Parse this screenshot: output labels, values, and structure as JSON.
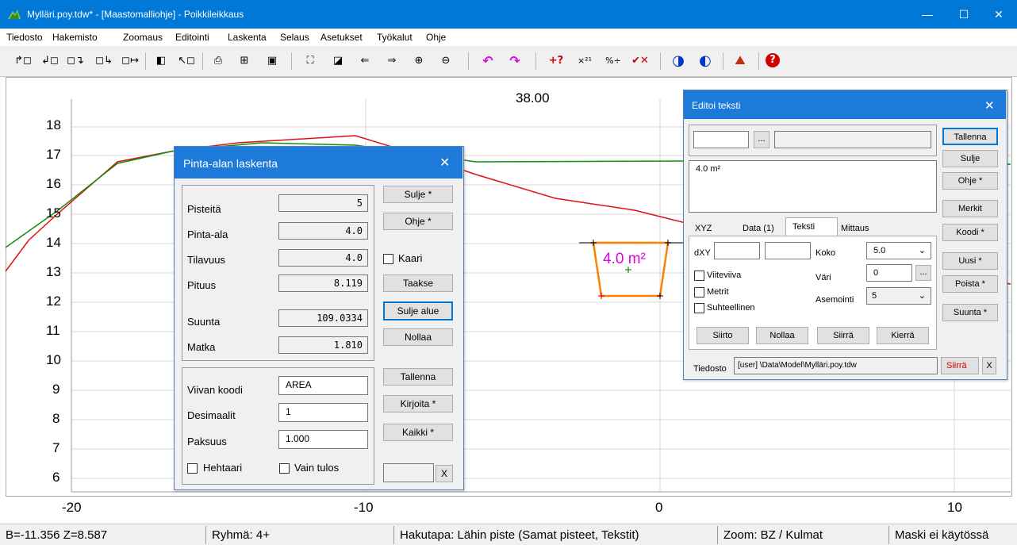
{
  "window": {
    "title": "Mylläri.poy.tdw* - [Maastomalliohje] - Poikkileikkaus",
    "minimize": "—",
    "maximize": "☐",
    "close": "✕"
  },
  "menu": [
    "Tiedosto",
    "Hakemisto",
    "Zoomaus",
    "Editointi",
    "Laskenta",
    "Selaus",
    "Asetukset",
    "Työkalut",
    "Ohje"
  ],
  "toolbar": {
    "icons": [
      "↱◻",
      "↲◻",
      "◻↴",
      "◻↳",
      "◻↦",
      "◧",
      "↖◻",
      "⎙",
      "⊞",
      "▣",
      "⛶",
      "◪",
      "⇐",
      "⇒",
      "⊕",
      "⊖",
      "↶",
      "↷",
      "+?",
      "×²¹",
      "%÷",
      "✔✕",
      "◑",
      "◐",
      "⛰",
      "?"
    ],
    "colors": {
      "magenta": "#e000e0",
      "blue": "#0033cc",
      "red": "#d00000"
    }
  },
  "plot": {
    "top_label": "38.00",
    "y_ticks": [
      "18",
      "17",
      "16",
      "15",
      "14",
      "13",
      "12",
      "11",
      "10",
      "9",
      "8",
      "7",
      "6"
    ],
    "x_ticks": [
      "-20",
      "-10",
      "0",
      "10"
    ],
    "area_label": "4.0 m²",
    "colors": {
      "ground": "#e01010",
      "design": "#109010",
      "area": "#ff8000",
      "text": "#e000e0",
      "grid": "#d8d8d8"
    }
  },
  "pinta_dialog": {
    "title": "Pinta-alan laskenta",
    "close": "✕",
    "rows": [
      {
        "label": "Pisteitä",
        "value": "5"
      },
      {
        "label": "Pinta-ala",
        "value": "4.0"
      },
      {
        "label": "Tilavuus",
        "value": "4.0"
      },
      {
        "label": "Pituus",
        "value": "8.119"
      },
      {
        "label": "Suunta",
        "value": "109.0334"
      },
      {
        "label": "Matka",
        "value": "1.810"
      }
    ],
    "inputs": [
      {
        "label": "Viivan koodi",
        "value": "AREA"
      },
      {
        "label": "Desimaalit",
        "value": "1"
      },
      {
        "label": "Paksuus",
        "value": "1.000"
      }
    ],
    "buttons": {
      "sulje": "Sulje *",
      "ohje": "Ohje *",
      "taakse": "Taakse",
      "sulje_alue": "Sulje alue",
      "nollaa": "Nollaa",
      "tallenna": "Tallenna",
      "kirjoita": "Kirjoita *",
      "kaikki": "Kaikki *",
      "x": "X"
    },
    "checks": {
      "kaari": "Kaari",
      "hehtaari": "Hehtaari",
      "vain_tulos": "Vain tulos"
    }
  },
  "editoi_dialog": {
    "title": "Editoi teksti",
    "close": "✕",
    "ellipsis": "...",
    "text_value": "4.0 m²",
    "tabs": [
      "XYZ",
      "Data (1)",
      "Teksti",
      "Mittaus"
    ],
    "labels": {
      "dxy": "dXY",
      "koko": "Koko",
      "vari": "Väri",
      "asemointi": "Asemointi",
      "tiedosto": "Tiedosto"
    },
    "koko_value": "5.0",
    "vari_value": "0",
    "asemointi_value": "5",
    "checks": {
      "viiteviiva": "Viiteviiva",
      "metrit": "Metrit",
      "suhteellinen": "Suhteellinen"
    },
    "bottom_buttons": [
      "Siirto",
      "Nollaa",
      "Siirrä",
      "Kierrä"
    ],
    "file_path": "[user] \\Data\\Model\\Mylläri.poy.tdw",
    "siirra_red": "Siirrä",
    "x": "X",
    "side_buttons": [
      "Tallenna",
      "Sulje",
      "Ohje *",
      "Merkit",
      "Koodi *",
      "Uusi *",
      "Poista *",
      "Suunta *"
    ]
  },
  "status": [
    "B=-11.356  Z=8.587",
    "Ryhmä: 4+",
    "Hakutapa: Lähin piste (Samat pisteet, Tekstit)",
    "Zoom: BZ  /  Kulmat",
    "Maski ei käytössä"
  ]
}
